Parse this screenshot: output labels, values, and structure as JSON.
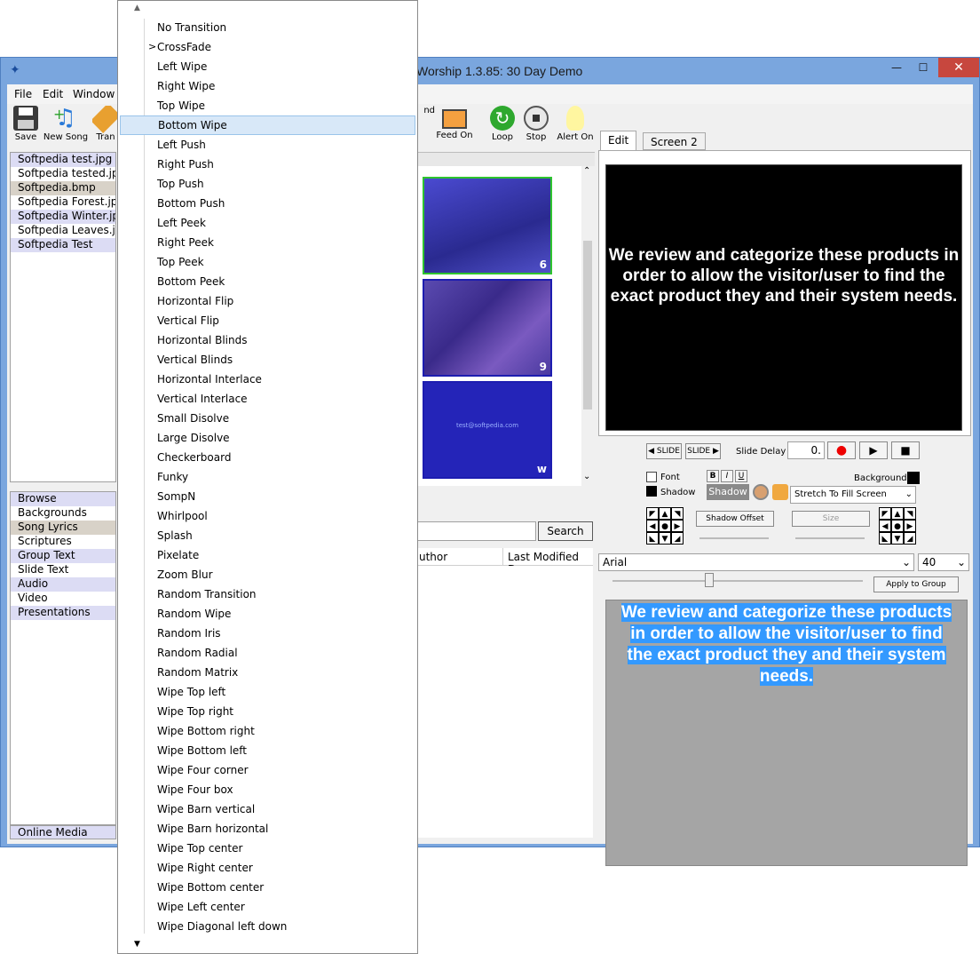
{
  "window": {
    "title": "Worship 1.3.85: 30 Day Demo",
    "min": "—",
    "max": "☐",
    "close": "✕"
  },
  "menu": [
    "File",
    "Edit",
    "Window"
  ],
  "toolbar": {
    "save": "Save",
    "new_song": "New Song",
    "transition": "Tran",
    "feed": "nd",
    "feed_on": "Feed On",
    "loop": "Loop",
    "stop": "Stop",
    "alert_on": "Alert On"
  },
  "files": [
    "Softpedia test.jpg",
    "Softpedia tested.jpg",
    "Softpedia.bmp",
    "Softpedia Forest.jpg",
    "Softpedia Winter.jpg",
    "Softpedia Leaves.j...",
    "Softpedia Test"
  ],
  "categories": [
    "Browse",
    "Backgrounds",
    "Song Lyrics",
    "Scriptures",
    "Group Text",
    "Slide Text",
    "Audio",
    "Video",
    "Presentations"
  ],
  "online_media": "Online Media",
  "thumbs": [
    {
      "num": "6"
    },
    {
      "num": "9"
    },
    {
      "num": "w",
      "text": "test@softpedia.com"
    }
  ],
  "search": {
    "button": "Search",
    "value": ""
  },
  "columns": {
    "author": "uthor",
    "modified": "Last Modified D..."
  },
  "right": {
    "tabs": [
      "Edit",
      "Screen 2"
    ],
    "preview_text": "We review and categorize these products in order to allow the visitor/user to find the exact product they and their system needs.",
    "slide_prev": "◀ SLIDE",
    "slide_next": "SLIDE ▶",
    "slide_delay_label": "Slide Delay",
    "slide_delay_value": "0.",
    "font_label": "Font",
    "shadow_label": "Shadow",
    "bold": "B",
    "italic": "I",
    "underline": "U",
    "shadow_btn": "Shadow",
    "background_label": "Background",
    "fill_mode": "Stretch To Fill Screen",
    "shadow_offset": "Shadow Offset",
    "size": "Size",
    "font_name": "Arial",
    "font_size": "40",
    "apply_group": "Apply to Group",
    "edit_lines": [
      "We review and categorize these products",
      "in order to allow the visitor/user to find",
      "the exact product they and their system",
      "needs."
    ]
  },
  "dropdown": {
    "selected": "CrossFade",
    "highlighted": "Bottom Wipe",
    "items": [
      "No Transition",
      "CrossFade",
      "Left Wipe",
      "Right Wipe",
      "Top Wipe",
      "Bottom Wipe",
      "Left Push",
      "Right Push",
      "Top Push",
      "Bottom Push",
      "Left Peek",
      "Right Peek",
      "Top Peek",
      "Bottom Peek",
      "Horizontal Flip",
      "Vertical Flip",
      "Horizontal Blinds",
      "Vertical Blinds",
      "Horizontal Interlace",
      "Vertical Interlace",
      "Small Disolve",
      "Large Disolve",
      "Checkerboard",
      "Funky",
      "SompN",
      "Whirlpool",
      "Splash",
      "Pixelate",
      "Zoom Blur",
      "Random Transition",
      "Random Wipe",
      "Random Iris",
      "Random Radial",
      "Random Matrix",
      "Wipe Top left",
      "Wipe Top right",
      "Wipe Bottom right",
      "Wipe Bottom left",
      "Wipe Four corner",
      "Wipe Four box",
      "Wipe Barn vertical",
      "Wipe Barn horizontal",
      "Wipe Top center",
      "Wipe Right center",
      "Wipe Bottom center",
      "Wipe Left center",
      "Wipe Diagonal left down"
    ]
  },
  "colors": {
    "titlebar": "#7aa6de",
    "close": "#c7473e",
    "thumb_border": "#1d1db0",
    "highlight": "#3399ff"
  }
}
